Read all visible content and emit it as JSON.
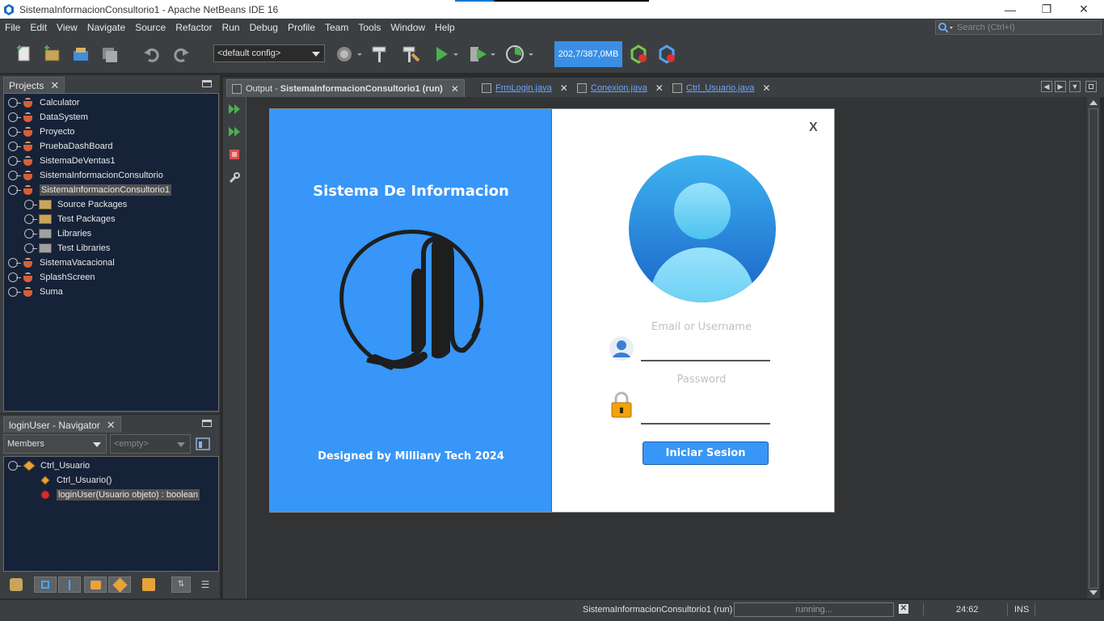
{
  "window": {
    "title": "SistemaInformacionConsultorio1 - Apache NetBeans IDE 16",
    "min": "—",
    "restore": "❐",
    "close": "✕"
  },
  "menu": [
    "File",
    "Edit",
    "View",
    "Navigate",
    "Source",
    "Refactor",
    "Run",
    "Debug",
    "Profile",
    "Team",
    "Tools",
    "Window",
    "Help"
  ],
  "search": {
    "placeholder": "Search (Ctrl+I)"
  },
  "toolbar": {
    "config": "<default config>",
    "memory": "202,7/387,0MB"
  },
  "projects_panel": {
    "tab": "Projects",
    "items": [
      {
        "label": "Calculator"
      },
      {
        "label": "DataSystem"
      },
      {
        "label": "Proyecto"
      },
      {
        "label": "PruebaDashBoard"
      },
      {
        "label": "SistemaDeVentas1"
      },
      {
        "label": "SistemaInformacionConsultorio"
      },
      {
        "label": "SistemaInformacionConsultorio1"
      },
      {
        "label": "Source Packages"
      },
      {
        "label": "Test Packages"
      },
      {
        "label": "Libraries"
      },
      {
        "label": "Test Libraries"
      },
      {
        "label": "SistemaVacacional"
      },
      {
        "label": "SplashScreen"
      },
      {
        "label": "Suma"
      }
    ]
  },
  "navigator_panel": {
    "tab": "loginUser - Navigator",
    "filter": "Members",
    "empty": "<empty>",
    "items": [
      {
        "label": "Ctrl_Usuario"
      },
      {
        "label": "Ctrl_Usuario()"
      },
      {
        "label": "loginUser(Usuario objeto) : boolean"
      }
    ]
  },
  "editor_tabs": [
    {
      "prefix": "Output - ",
      "label": "SistemaInformacionConsultorio1 (run)"
    },
    {
      "label": "FrmLogin.java"
    },
    {
      "label": "Conexion.java"
    },
    {
      "label": "Ctrl_Usuario.java"
    }
  ],
  "login_window": {
    "brand_title": "Sistema De Informacion",
    "brand_footer": "Designed by Milliany Tech 2024",
    "close": "X",
    "email_label": "Email or Username",
    "password_label": "Password",
    "button": "Iniciar Sesion"
  },
  "statusbar": {
    "project": "SistemaInformacionConsultorio1 (run)",
    "progress": "running...",
    "position": "24:62",
    "mode": "INS"
  },
  "colors": {
    "brand_blue": "#3796f7",
    "memory_blue": "#3a8fe5",
    "tree_bg": "#162238"
  }
}
